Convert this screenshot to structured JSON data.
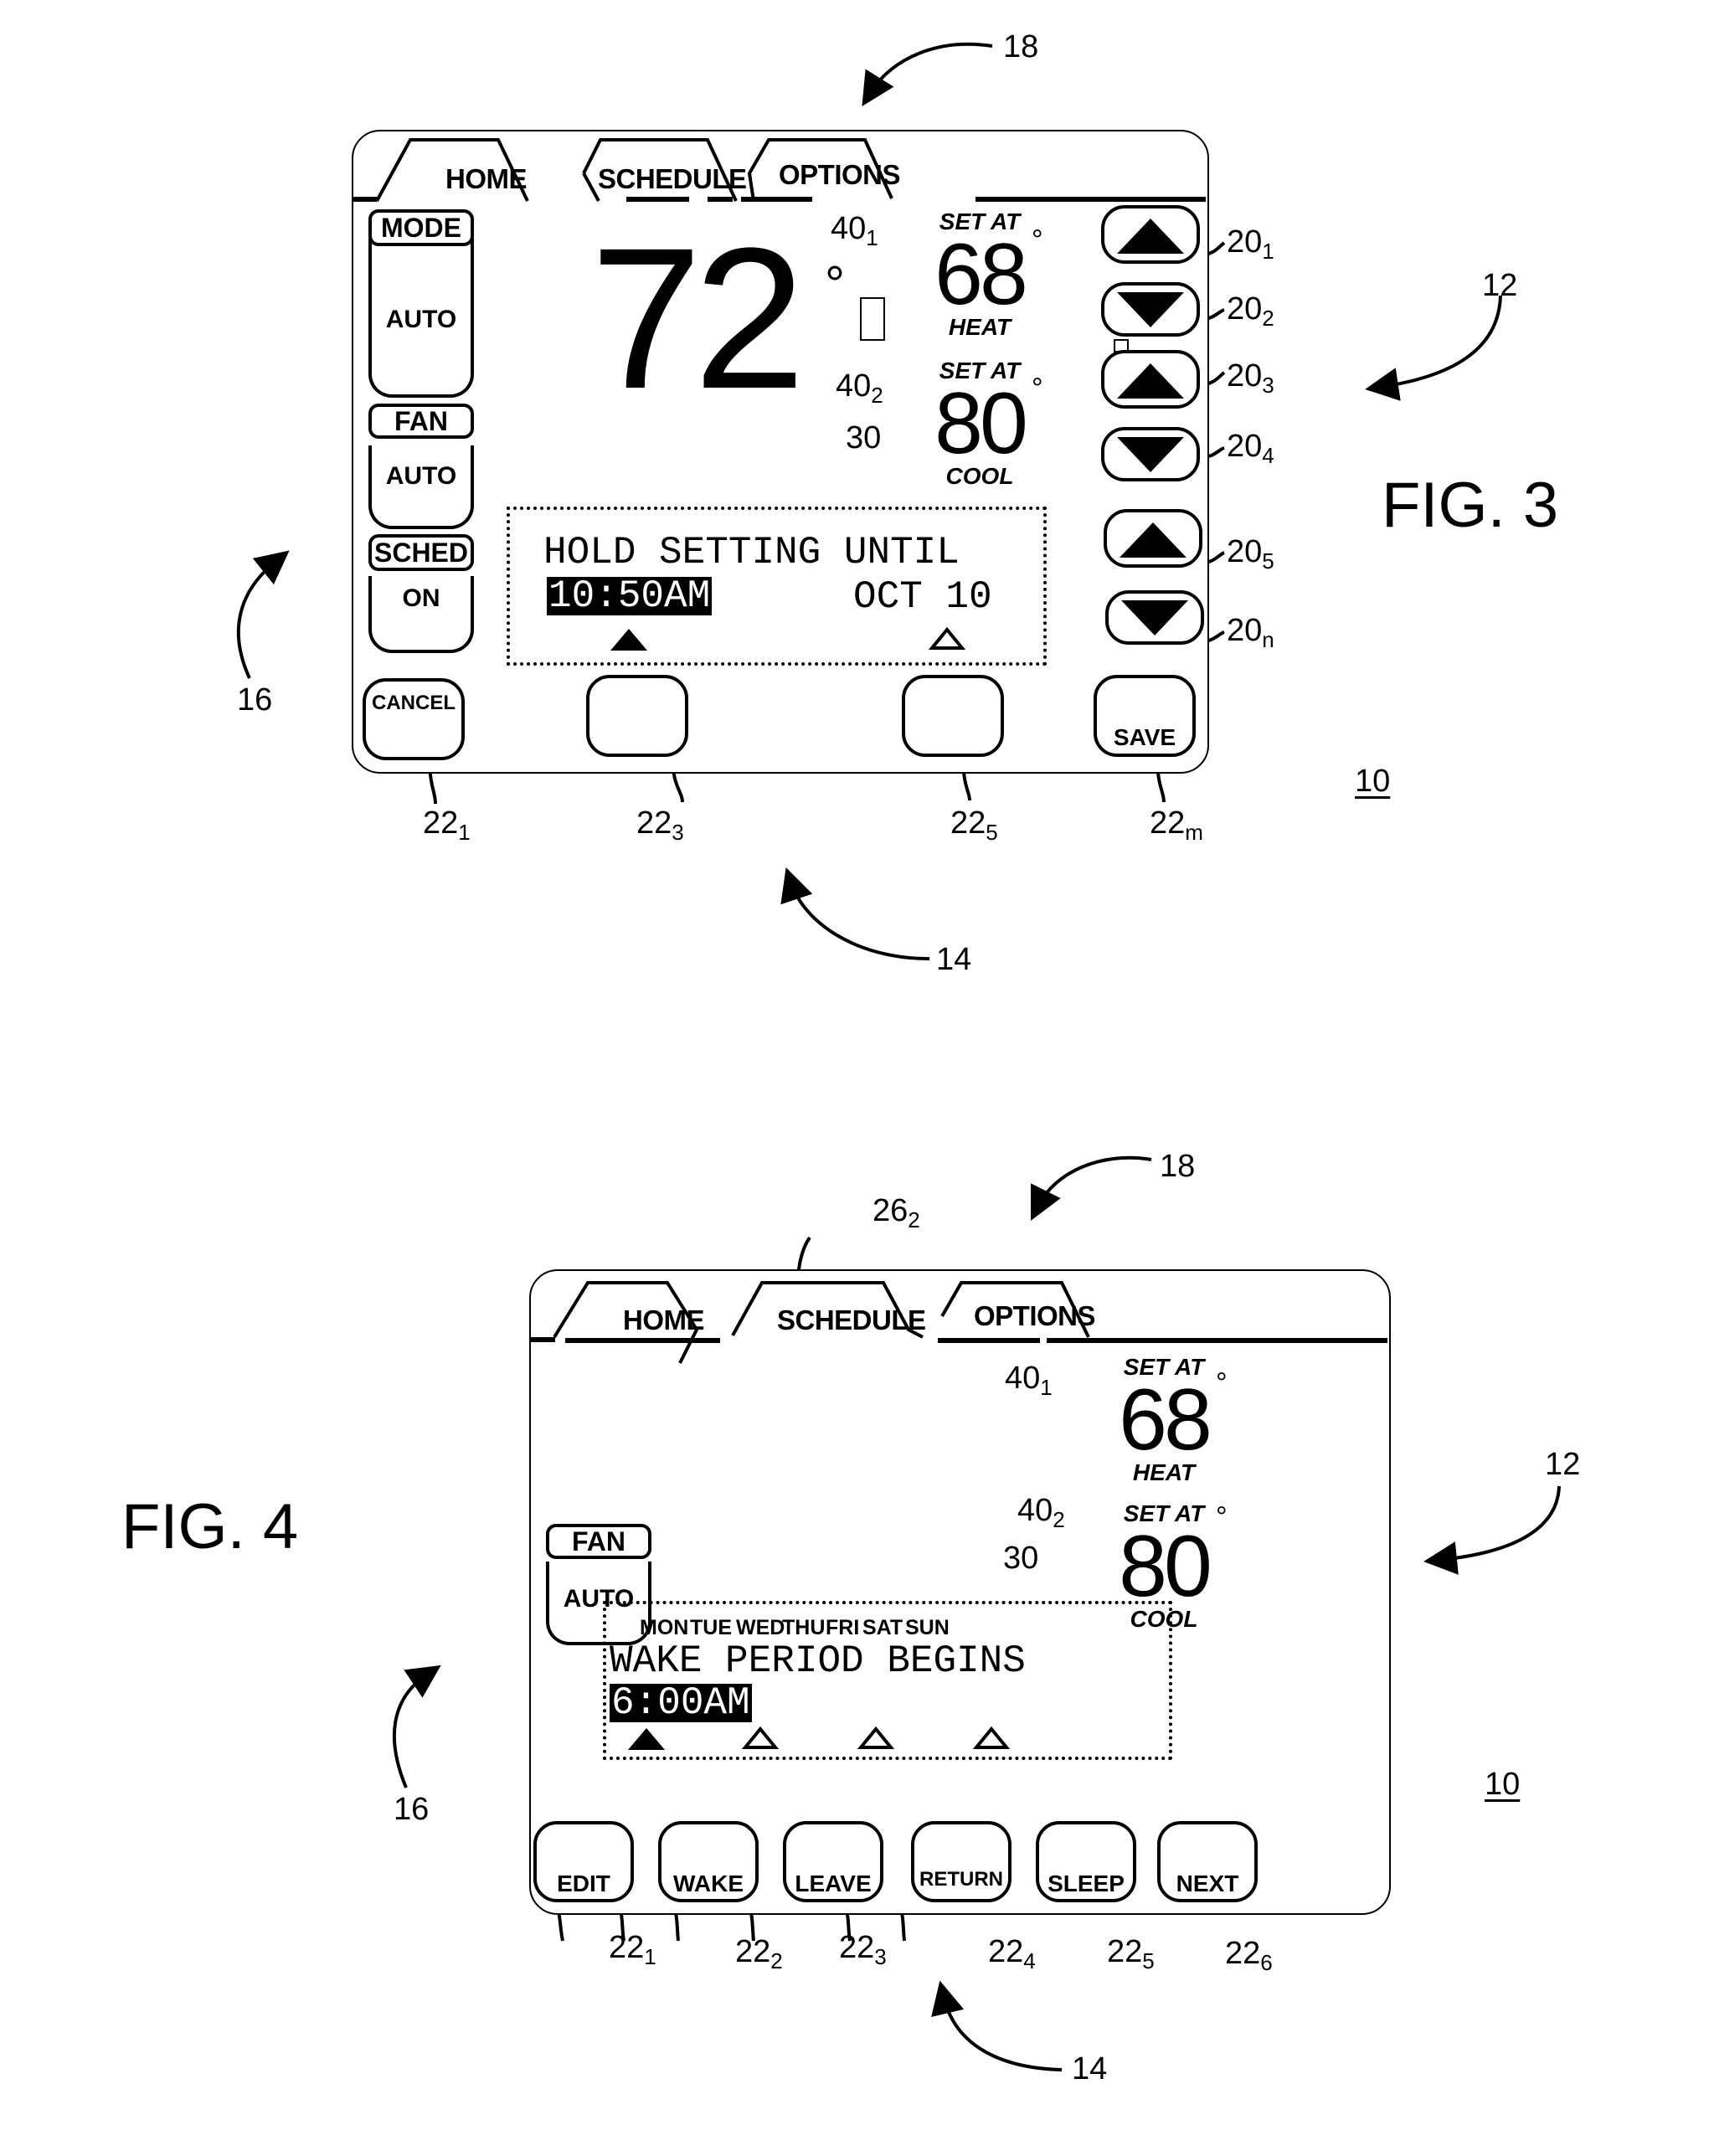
{
  "fig3": {
    "figure_label": "FIG. 3",
    "device_ref": "10",
    "refs": {
      "tabs_group": "18",
      "right_group": "12",
      "bottom_group": "14",
      "left_group": "16",
      "display": "30"
    },
    "tabs": [
      {
        "label": "HOME",
        "active": true
      },
      {
        "label": "SCHEDULE",
        "active": false
      },
      {
        "label": "OPTIONS",
        "active": false
      }
    ],
    "side": {
      "mode": {
        "label": "MODE",
        "value": "AUTO"
      },
      "fan": {
        "label": "FAN",
        "value": "AUTO"
      },
      "sched": {
        "label": "SCHED",
        "value": "ON"
      }
    },
    "current_temp": "72",
    "degree_symbol": "°",
    "setpoints": [
      {
        "ref": "40",
        "ref_sub": "1",
        "label": "SET AT",
        "value": "68",
        "mode": "HEAT"
      },
      {
        "ref": "40",
        "ref_sub": "2",
        "label": "SET AT",
        "value": "80",
        "mode": "COOL"
      }
    ],
    "display": {
      "line1": "HOLD SETTING UNTIL",
      "time": "10:50AM",
      "date": "OCT 10"
    },
    "arrow_buttons": [
      {
        "direction": "up",
        "ref": "20",
        "ref_sub": "1"
      },
      {
        "direction": "down",
        "ref": "20",
        "ref_sub": "2"
      },
      {
        "direction": "up",
        "ref": "20",
        "ref_sub": "3"
      },
      {
        "direction": "down",
        "ref": "20",
        "ref_sub": "4"
      },
      {
        "direction": "up",
        "ref": "20",
        "ref_sub": "5"
      },
      {
        "direction": "down",
        "ref": "20",
        "ref_sub": "n"
      }
    ],
    "soft_buttons": [
      {
        "label": "CANCEL",
        "ref": "22",
        "ref_sub": "1"
      },
      {
        "label": "",
        "ref": "22",
        "ref_sub": "3"
      },
      {
        "label": "",
        "ref": "22",
        "ref_sub": "5"
      },
      {
        "label": "SAVE",
        "ref": "22",
        "ref_sub": "m"
      }
    ]
  },
  "fig4": {
    "figure_label": "FIG. 4",
    "device_ref": "10",
    "refs": {
      "tabs_group": "18",
      "active_tab": "26",
      "active_tab_sub": "2",
      "right_group": "12",
      "bottom_group": "14",
      "left_group": "16",
      "display": "30"
    },
    "tabs": [
      {
        "label": "HOME",
        "active": false
      },
      {
        "label": "SCHEDULE",
        "active": true
      },
      {
        "label": "OPTIONS",
        "active": false
      }
    ],
    "side": {
      "fan": {
        "label": "FAN",
        "value": "AUTO"
      }
    },
    "setpoints": [
      {
        "ref": "40",
        "ref_sub": "1",
        "label": "SET AT",
        "value": "68",
        "mode": "HEAT"
      },
      {
        "ref": "40",
        "ref_sub": "2",
        "label": "SET AT",
        "value": "80",
        "mode": "COOL"
      }
    ],
    "display": {
      "days": [
        "MON",
        "TUE",
        "WED",
        "THU",
        "FRI",
        "SAT",
        "SUN"
      ],
      "line1": "WAKE PERIOD BEGINS",
      "time": "6:00AM"
    },
    "soft_buttons": [
      {
        "label": "EDIT",
        "ref": "22",
        "ref_sub": "1"
      },
      {
        "label": "WAKE",
        "ref": "22",
        "ref_sub": "2"
      },
      {
        "label": "LEAVE",
        "ref": "22",
        "ref_sub": "3"
      },
      {
        "label": "RETURN",
        "ref": "22",
        "ref_sub": "4"
      },
      {
        "label": "SLEEP",
        "ref": "22",
        "ref_sub": "5"
      },
      {
        "label": "NEXT",
        "ref": "22",
        "ref_sub": "6"
      }
    ]
  }
}
